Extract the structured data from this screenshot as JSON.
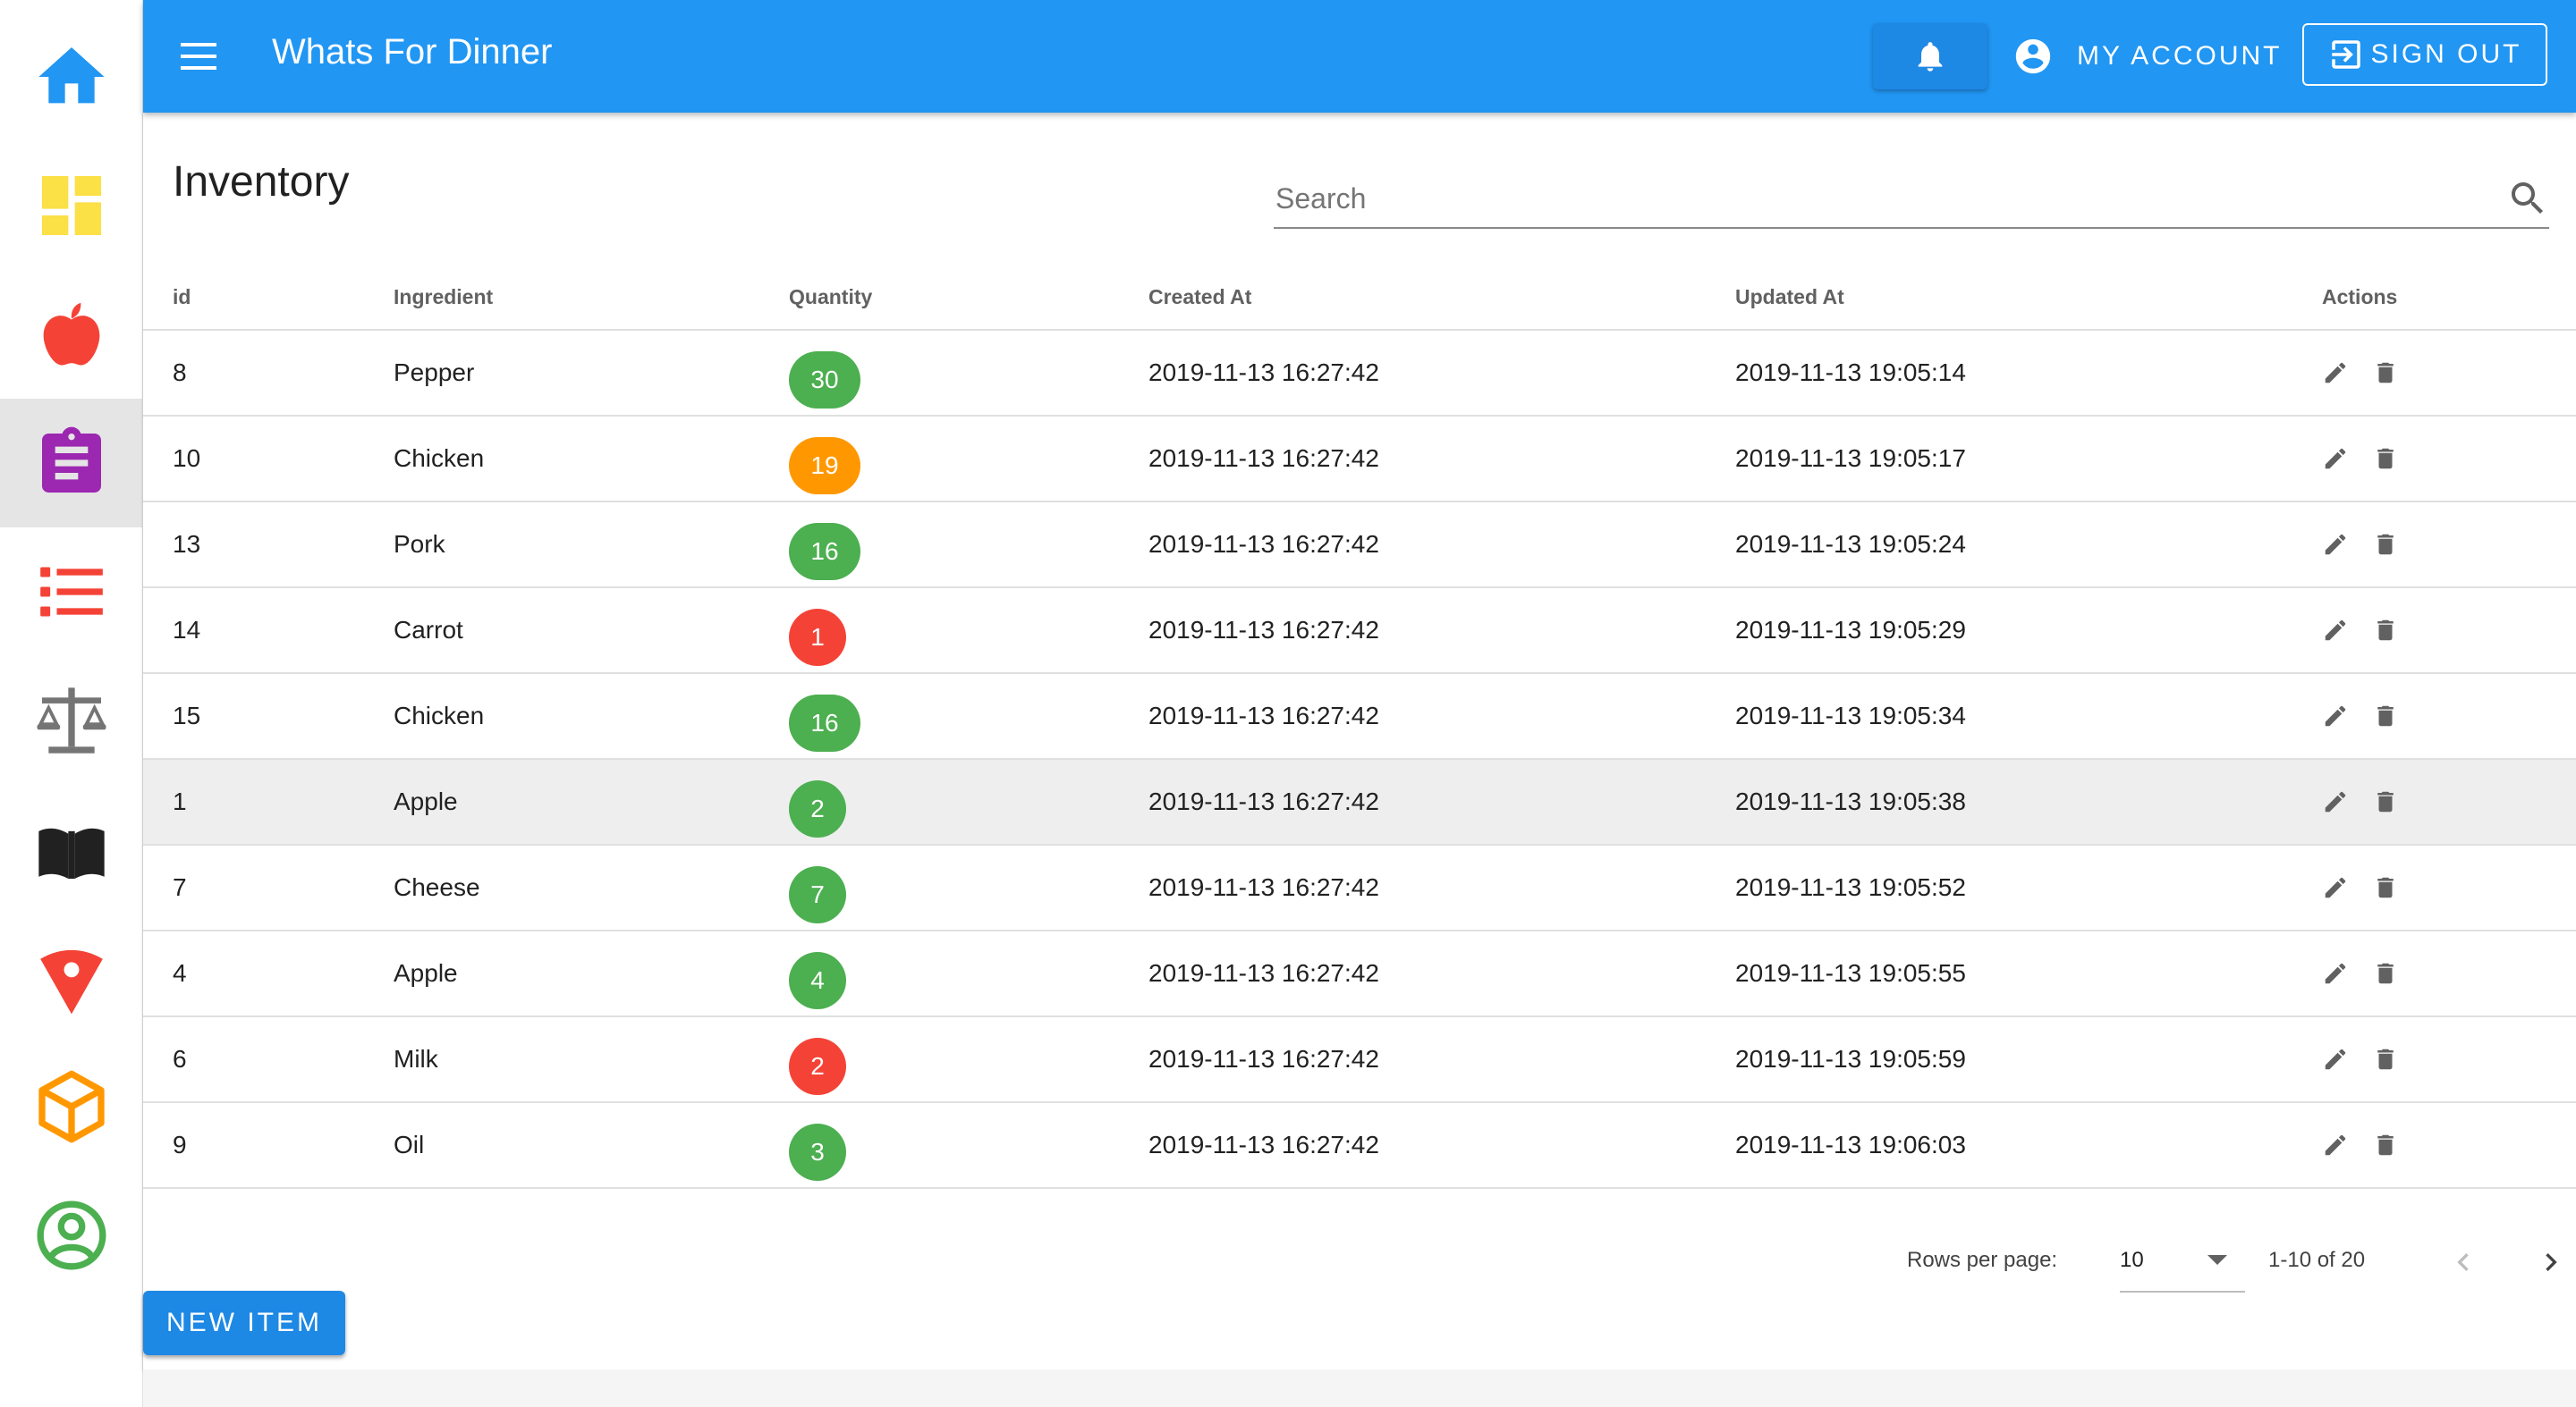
{
  "app": {
    "title": "Whats For Dinner",
    "account_label": "MY ACCOUNT",
    "signout_label": "SIGN OUT"
  },
  "sidebar": {
    "active_index": 3,
    "items": [
      {
        "icon": "home-icon",
        "color": "#2196f3"
      },
      {
        "icon": "dashboard-icon",
        "color": "#fbe046"
      },
      {
        "icon": "apple-icon",
        "color": "#f44336"
      },
      {
        "icon": "clipboard-icon",
        "color": "#9c27b0"
      },
      {
        "icon": "list-icon",
        "color": "#f44336"
      },
      {
        "icon": "scale-icon",
        "color": "#757575"
      },
      {
        "icon": "book-icon",
        "color": "#212121"
      },
      {
        "icon": "pizza-icon",
        "color": "#f44336"
      },
      {
        "icon": "box-icon",
        "color": "#ff9800"
      },
      {
        "icon": "account-circle-icon",
        "color": "#4caf50"
      }
    ]
  },
  "page": {
    "title": "Inventory",
    "search_placeholder": "Search"
  },
  "table": {
    "headers": {
      "id": "id",
      "ingredient": "Ingredient",
      "quantity": "Quantity",
      "created_at": "Created At",
      "updated_at": "Updated At",
      "actions": "Actions"
    },
    "hovered_row": 5,
    "rows": [
      {
        "id": "8",
        "ingredient": "Pepper",
        "quantity": "30",
        "quantity_color": "#4caf50",
        "created_at": "2019-11-13 16:27:42",
        "updated_at": "2019-11-13 19:05:14"
      },
      {
        "id": "10",
        "ingredient": "Chicken",
        "quantity": "19",
        "quantity_color": "#ff9800",
        "created_at": "2019-11-13 16:27:42",
        "updated_at": "2019-11-13 19:05:17"
      },
      {
        "id": "13",
        "ingredient": "Pork",
        "quantity": "16",
        "quantity_color": "#4caf50",
        "created_at": "2019-11-13 16:27:42",
        "updated_at": "2019-11-13 19:05:24"
      },
      {
        "id": "14",
        "ingredient": "Carrot",
        "quantity": "1",
        "quantity_color": "#f44336",
        "created_at": "2019-11-13 16:27:42",
        "updated_at": "2019-11-13 19:05:29"
      },
      {
        "id": "15",
        "ingredient": "Chicken",
        "quantity": "16",
        "quantity_color": "#4caf50",
        "created_at": "2019-11-13 16:27:42",
        "updated_at": "2019-11-13 19:05:34"
      },
      {
        "id": "1",
        "ingredient": "Apple",
        "quantity": "2",
        "quantity_color": "#4caf50",
        "created_at": "2019-11-13 16:27:42",
        "updated_at": "2019-11-13 19:05:38"
      },
      {
        "id": "7",
        "ingredient": "Cheese",
        "quantity": "7",
        "quantity_color": "#4caf50",
        "created_at": "2019-11-13 16:27:42",
        "updated_at": "2019-11-13 19:05:52"
      },
      {
        "id": "4",
        "ingredient": "Apple",
        "quantity": "4",
        "quantity_color": "#4caf50",
        "created_at": "2019-11-13 16:27:42",
        "updated_at": "2019-11-13 19:05:55"
      },
      {
        "id": "6",
        "ingredient": "Milk",
        "quantity": "2",
        "quantity_color": "#f44336",
        "created_at": "2019-11-13 16:27:42",
        "updated_at": "2019-11-13 19:05:59"
      },
      {
        "id": "9",
        "ingredient": "Oil",
        "quantity": "3",
        "quantity_color": "#4caf50",
        "created_at": "2019-11-13 16:27:42",
        "updated_at": "2019-11-13 19:06:03"
      }
    ]
  },
  "pagination": {
    "rows_per_page_label": "Rows per page:",
    "rows_per_page_value": "10",
    "range_label": "1-10 of 20"
  },
  "actions": {
    "new_item_label": "NEW ITEM"
  },
  "colors": {
    "primary": "#2196f3",
    "button": "#1e88e5",
    "chip_green": "#4caf50",
    "chip_orange": "#ff9800",
    "chip_red": "#f44336"
  }
}
